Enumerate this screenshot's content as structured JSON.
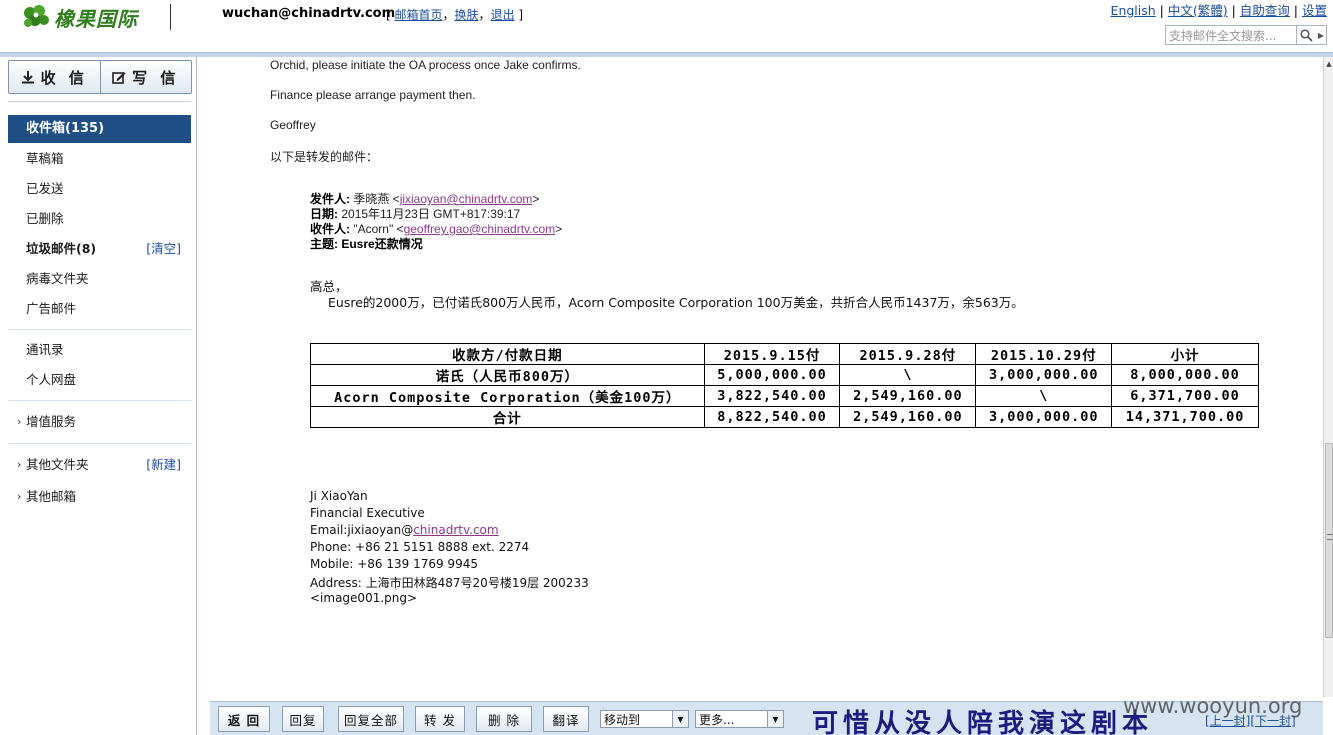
{
  "header": {
    "logo_text": "橡果国际",
    "user_email": "wuchan@chinadrtv.com",
    "user_links": [
      "邮箱首页",
      "换肤",
      "退出"
    ],
    "top_links": [
      "English",
      "中文(繁體)",
      "自助查询",
      "设置"
    ],
    "search_placeholder": "支持邮件全文搜索..."
  },
  "sidebar": {
    "receive_label": "收 信",
    "compose_label": "写 信",
    "inbox": "收件箱(135)",
    "drafts": "草稿箱",
    "sent": "已发送",
    "deleted": "已删除",
    "spam": "垃圾邮件(8)",
    "spam_action": "[清空]",
    "virus": "病毒文件夹",
    "ads": "广告邮件",
    "contacts": "通讯录",
    "netdisk": "个人网盘",
    "value_added": "增值服务",
    "other_folders": "其他文件夹",
    "other_folders_action": "[新建]",
    "other_mailboxes": "其他邮箱"
  },
  "email": {
    "line1": "Orchid, please initiate the OA process once Jake confirms.",
    "line2": "Finance please arrange payment then.",
    "signoff": "Geoffrey",
    "forward_intro": "以下是转发的邮件：",
    "forwarded": {
      "from_label": "发件人:",
      "from_name": "季晓燕 <",
      "from_email": "jixiaoyan@chinadrtv.com",
      "from_close": ">",
      "date_label": "日期:",
      "date_value": "2015年11月23日 GMT+817:39:17",
      "to_label": "收件人:",
      "to_name": "\"Acorn\" <",
      "to_email": "geoffrey.gao@chinadrtv.com",
      "to_close": ">",
      "subject_label": "主题:",
      "subject_value": "Eusre还款情况"
    },
    "greeting": "高总，",
    "body": "Eusre的2000万，已付诺氏800万人民币，Acorn Composite Corporation 100万美金，共折合人民币1437万，余563万。",
    "table": {
      "headers": [
        "收款方/付款日期",
        "2015.9.15付",
        "2015.9.28付",
        "2015.10.29付",
        "小计"
      ],
      "rows": [
        [
          "诺氏（人民币800万）",
          "5,000,000.00",
          "\\",
          "3,000,000.00",
          "8,000,000.00"
        ],
        [
          "Acorn Composite Corporation（美金100万）",
          "3,822,540.00",
          "2,549,160.00",
          "\\",
          "6,371,700.00"
        ],
        [
          "合计",
          "8,822,540.00",
          "2,549,160.00",
          "3,000,000.00",
          "14,371,700.00"
        ]
      ]
    },
    "signature": {
      "name": "Ji XiaoYan",
      "title": "Financial Executive",
      "email_prefix": "Email:jixiaoyan@",
      "email_domain": "chinadrtv.com",
      "phone": "Phone: +86 21 5151 8888 ext. 2274",
      "mobile": "Mobile: +86 139 1769 9945",
      "address": "Address: 上海市田林路487号20号楼19层 200233",
      "attachment": "<image001.png>"
    }
  },
  "toolbar": {
    "back": "返 回",
    "reply": "回复",
    "reply_all": "回复全部",
    "forward": "转 发",
    "delete": "删 除",
    "translate": "翻译",
    "move_to": "移动到",
    "more": "更多...",
    "prev": "[上一封]",
    "next": "[下一封]"
  },
  "overlay": {
    "caption": "可惜从没人陪我演这剧本",
    "watermark": "www.wooyun.org"
  },
  "colors": {
    "active_folder_bg": "#1f4f85",
    "link": "#1c4e9e",
    "logo_green": "#2f7d1d",
    "toolbar_bg": "#d6e3f1"
  }
}
